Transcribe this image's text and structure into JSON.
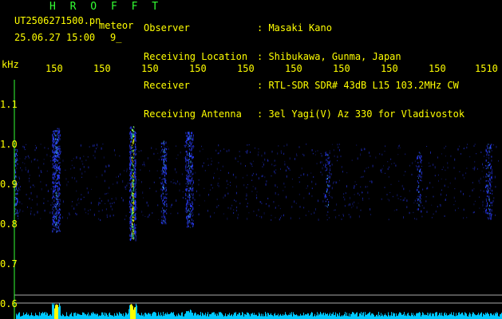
{
  "header": {
    "title": "H R O F F T",
    "filename": "UT2506271500.pn",
    "meteor_label": "meteor",
    "timestamp": "25.06.27 15:00",
    "count": "9_",
    "info": [
      {
        "label": "Observer",
        "value": ": Masaki Kano"
      },
      {
        "label": "Receiving Location",
        "value": ": Shibukawa, Gunma, Japan"
      },
      {
        "label": "Receiver",
        "value": ": RTL-SDR SDR# 43dB L15 103.2MHz CW"
      },
      {
        "label": "Receiving Antenna",
        "value": ": 3el Yagi(V) Az 330 for Vladivostok"
      }
    ]
  },
  "axes": {
    "y_unit": "kHz",
    "y_ticks": [
      "1.1",
      "1.0",
      "0.9",
      "0.8",
      "0.7",
      "0.6"
    ],
    "x_ticks": [
      "150",
      "150",
      "150",
      "150",
      "150",
      "150",
      "150",
      "150",
      "150",
      "1510"
    ]
  },
  "colors": {
    "label_green": "#33ff33",
    "text_yellow": "#ffff00",
    "background": "#000000",
    "signal_blue": "#2a3cff",
    "signal_peak": "#ffff00",
    "bottom_bar": "#00c8ff"
  }
}
